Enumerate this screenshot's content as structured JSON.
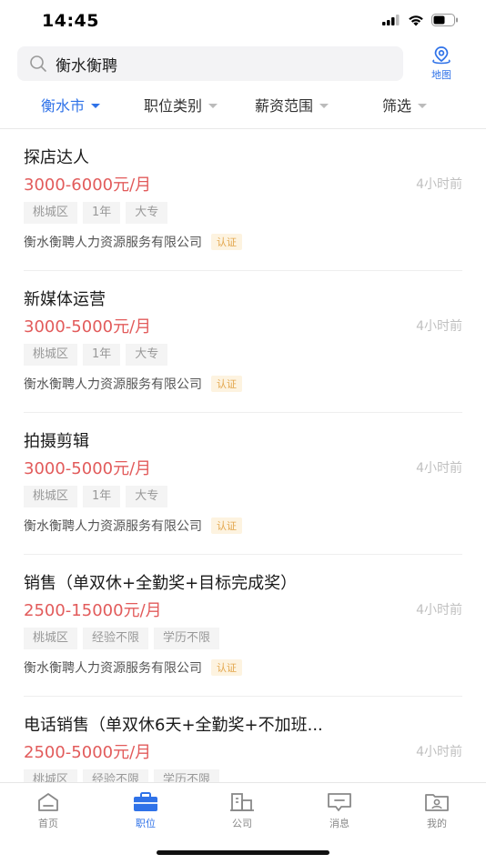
{
  "status": {
    "time": "14:45"
  },
  "search": {
    "query": "衡水衡聘"
  },
  "map": {
    "label": "地图"
  },
  "filters": [
    {
      "label": "衡水市"
    },
    {
      "label": "职位类别"
    },
    {
      "label": "薪资范围"
    },
    {
      "label": "筛选"
    }
  ],
  "jobs": [
    {
      "title": "探店达人",
      "salary": "3000-6000元/月",
      "time": "4小时前",
      "tags": [
        "桃城区",
        "1年",
        "大专"
      ],
      "company": "衡水衡聘人力资源服务有限公司",
      "badge": "认证"
    },
    {
      "title": "新媒体运营",
      "salary": "3000-5000元/月",
      "time": "4小时前",
      "tags": [
        "桃城区",
        "1年",
        "大专"
      ],
      "company": "衡水衡聘人力资源服务有限公司",
      "badge": "认证"
    },
    {
      "title": "拍摄剪辑",
      "salary": "3000-5000元/月",
      "time": "4小时前",
      "tags": [
        "桃城区",
        "1年",
        "大专"
      ],
      "company": "衡水衡聘人力资源服务有限公司",
      "badge": "认证"
    },
    {
      "title": "销售（单双休+全勤奖+目标完成奖）",
      "salary": "2500-15000元/月",
      "time": "4小时前",
      "tags": [
        "桃城区",
        "经验不限",
        "学历不限"
      ],
      "company": "衡水衡聘人力资源服务有限公司",
      "badge": "认证"
    },
    {
      "title": "电话销售（单双休6天+全勤奖+不加班...",
      "salary": "2500-5000元/月",
      "time": "4小时前",
      "tags": [
        "桃城区",
        "经验不限",
        "学历不限"
      ],
      "company": "",
      "badge": ""
    }
  ],
  "tabs": [
    {
      "label": "首页",
      "icon": "home-icon"
    },
    {
      "label": "职位",
      "icon": "briefcase-icon"
    },
    {
      "label": "公司",
      "icon": "building-icon"
    },
    {
      "label": "消息",
      "icon": "message-icon"
    },
    {
      "label": "我的",
      "icon": "profile-icon"
    }
  ],
  "colors": {
    "accent": "#2f72e8",
    "salary": "#e25b5b",
    "badge": "#e3a64c"
  }
}
